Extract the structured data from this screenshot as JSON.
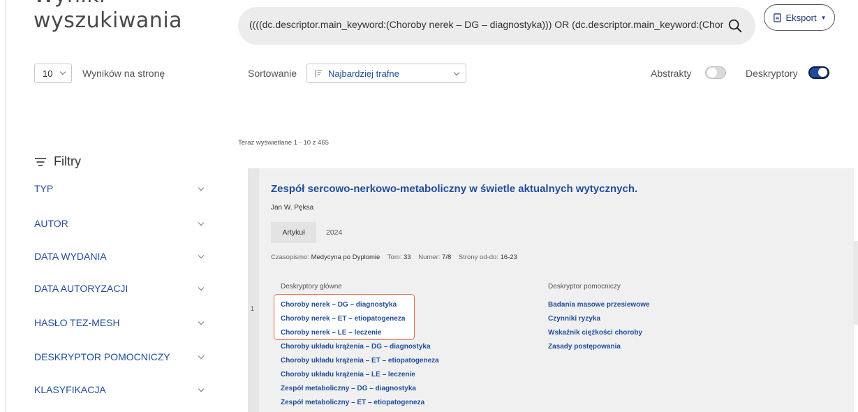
{
  "header": {
    "title": "wyszukiwania",
    "search_query": "((((dc.descriptor.main_keyword:(Choroby nerek – DG – diagnostyka))) OR (dc.descriptor.main_keyword:(Chor",
    "export_label": "Eksport"
  },
  "controls": {
    "per_page_value": "10",
    "per_page_label": "Wyników na stronę",
    "sort_label": "Sortowanie",
    "sort_value": "Najbardziej trafne",
    "abstracts_label": "Abstrakty",
    "abstracts_on": false,
    "descriptors_label": "Deskryptory",
    "descriptors_on": true
  },
  "status": "Teraz wyświetlane 1 - 10 z 465",
  "filters": {
    "title": "Filtry",
    "items": [
      "TYP",
      "AUTOR",
      "DATA WYDANIA",
      "DATA AUTORYZACJI",
      "HASŁO TEZ-MESH",
      "DESKRYPTOR POMOCNICZY",
      "KLASYFIKACJA"
    ]
  },
  "result": {
    "number": "1",
    "title": "Zespół sercowo-nerkowo-metaboliczny w świetle aktualnych wytycznych.",
    "author": "Jan W. Pęksa",
    "type": "Artykuł",
    "year": "2024",
    "journal_label": "Czasopismo:",
    "journal": "Medycyna po Dyplomie",
    "volume_label": "Tom:",
    "volume": "33",
    "issue_label": "Numer:",
    "issue": "7/8",
    "pages_label": "Strony od-do:",
    "pages": "16-23",
    "main_descriptors_label": "Deskryptory główne",
    "main_descriptors": [
      "Choroby nerek – DG – diagnostyka",
      "Choroby nerek – ET – etiopatogeneza",
      "Choroby nerek – LE – leczenie",
      "Choroby układu krążenia – DG – diagnostyka",
      "Choroby układu krążenia – ET – etiopatogeneza",
      "Choroby układu krążenia – LE – leczenie",
      "Zespół metaboliczny – DG – diagnostyka",
      "Zespół metaboliczny – ET – etiopatogeneza"
    ],
    "aux_descriptors_label": "Deskryptor pomocniczy",
    "aux_descriptors": [
      "Badania masowe przesiewowe",
      "Czynniki ryzyka",
      "Wskaźnik ciężkości choroby",
      "Zasady postępowania"
    ]
  },
  "colors": {
    "link": "#1f4d9c",
    "highlight_border": "#e06a4a",
    "toggle_on": "#1f4d9c"
  }
}
